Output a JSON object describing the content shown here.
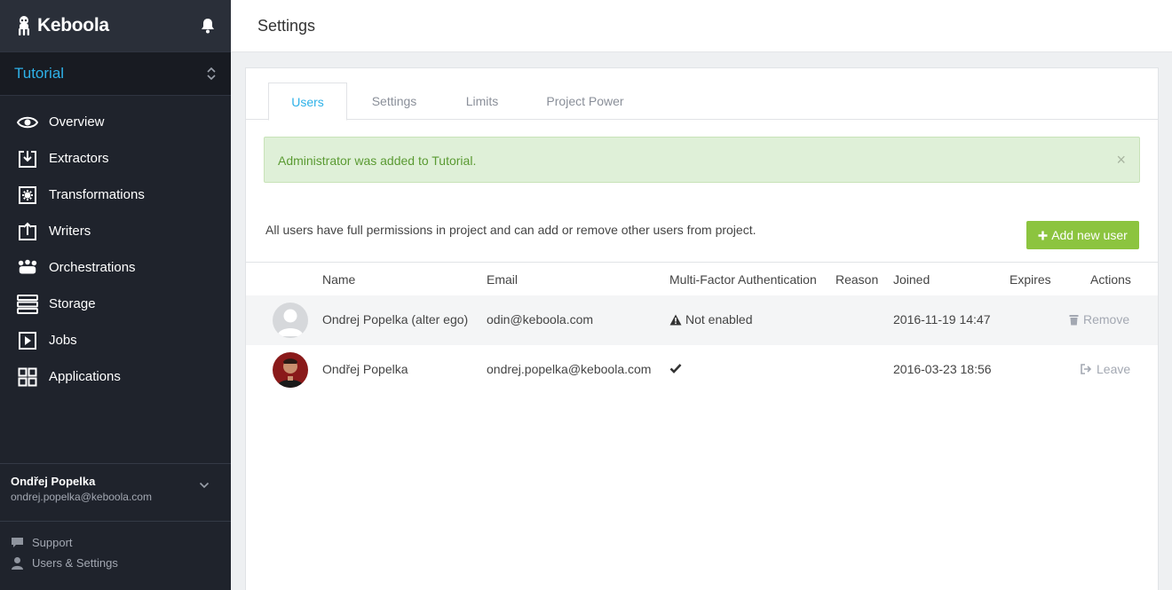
{
  "brand": {
    "name": "Keboola"
  },
  "project": {
    "name": "Tutorial"
  },
  "nav": [
    {
      "label": "Overview",
      "icon": "eye-icon"
    },
    {
      "label": "Extractors",
      "icon": "extractor-icon"
    },
    {
      "label": "Transformations",
      "icon": "transformation-icon"
    },
    {
      "label": "Writers",
      "icon": "writer-icon"
    },
    {
      "label": "Orchestrations",
      "icon": "orchestration-icon"
    },
    {
      "label": "Storage",
      "icon": "storage-icon"
    },
    {
      "label": "Jobs",
      "icon": "jobs-icon"
    },
    {
      "label": "Applications",
      "icon": "applications-icon"
    }
  ],
  "current_user": {
    "name": "Ondřej Popelka",
    "email": "ondrej.popelka@keboola.com"
  },
  "footer": {
    "support": "Support",
    "users_settings": "Users & Settings"
  },
  "header": {
    "title": "Settings"
  },
  "tabs": [
    {
      "label": "Users",
      "active": true
    },
    {
      "label": "Settings",
      "active": false
    },
    {
      "label": "Limits",
      "active": false
    },
    {
      "label": "Project Power",
      "active": false
    }
  ],
  "alert": {
    "message": "Administrator was added to Tutorial.",
    "close": "×"
  },
  "info_text": "All users have full permissions in project and can add or remove other users from project.",
  "add_button": {
    "label": "Add new user"
  },
  "table": {
    "headers": {
      "name": "Name",
      "email": "Email",
      "mfa": "Multi-Factor Authentication",
      "reason": "Reason",
      "joined": "Joined",
      "expires": "Expires",
      "actions": "Actions"
    },
    "rows": [
      {
        "name": "Ondrej Popelka (alter ego)",
        "email": "odin@keboola.com",
        "mfa": "Not enabled",
        "reason": "",
        "joined": "2016-11-19 14:47",
        "expires": "",
        "action": "Remove"
      },
      {
        "name": "Ondřej Popelka",
        "email": "ondrej.popelka@keboola.com",
        "mfa": "",
        "reason": "",
        "joined": "2016-03-23 18:56",
        "expires": "",
        "action": "Leave"
      }
    ]
  },
  "colors": {
    "accent": "#2eb1e8",
    "success": "#8cc43f",
    "sidebar": "#1f232c"
  }
}
